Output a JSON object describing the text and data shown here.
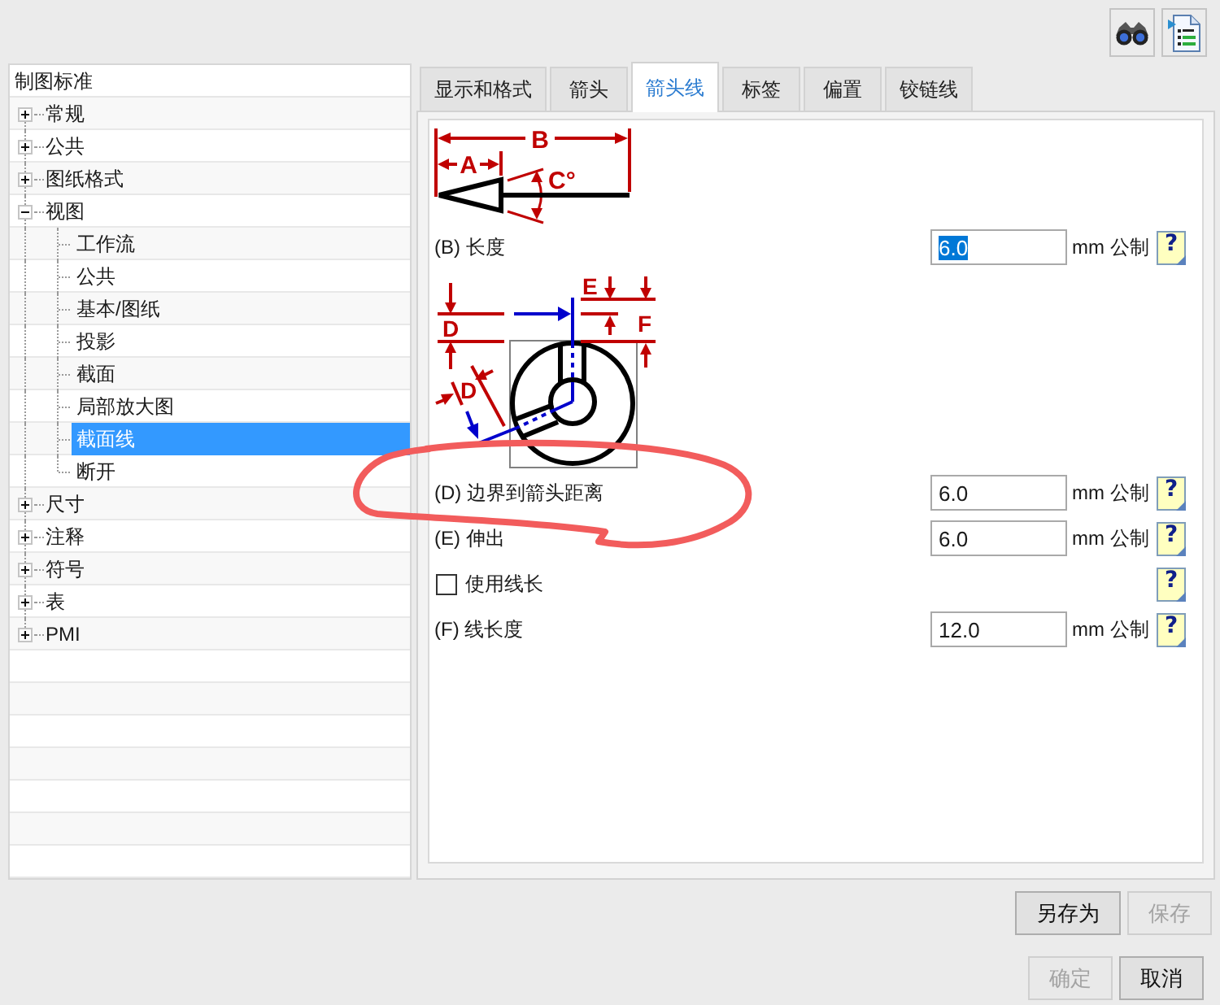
{
  "tree": {
    "title": "制图标准",
    "items": [
      {
        "label": "常规",
        "expanded": false,
        "selected": false
      },
      {
        "label": "公共",
        "expanded": false,
        "selected": false
      },
      {
        "label": "图纸格式",
        "expanded": false,
        "selected": false
      },
      {
        "label": "视图",
        "expanded": true,
        "selected": false,
        "children": [
          {
            "label": "工作流",
            "selected": false
          },
          {
            "label": "公共",
            "selected": false
          },
          {
            "label": "基本/图纸",
            "selected": false
          },
          {
            "label": "投影",
            "selected": false
          },
          {
            "label": "截面",
            "selected": false
          },
          {
            "label": "局部放大图",
            "selected": false
          },
          {
            "label": "截面线",
            "selected": true
          },
          {
            "label": "断开",
            "selected": false
          }
        ]
      },
      {
        "label": "尺寸",
        "expanded": false,
        "selected": false
      },
      {
        "label": "注释",
        "expanded": false,
        "selected": false
      },
      {
        "label": "符号",
        "expanded": false,
        "selected": false
      },
      {
        "label": "表",
        "expanded": false,
        "selected": false
      },
      {
        "label": "PMI",
        "expanded": false,
        "selected": false
      }
    ]
  },
  "tabs": [
    {
      "label": "显示和格式",
      "selected": false
    },
    {
      "label": "箭头",
      "selected": false
    },
    {
      "label": "箭头线",
      "selected": true
    },
    {
      "label": "标签",
      "selected": false
    },
    {
      "label": "偏置",
      "selected": false
    },
    {
      "label": "铰链线",
      "selected": false
    }
  ],
  "panel": {
    "blocks": [
      {
        "kind": "arrow-diagram",
        "labels": [
          "B",
          "A",
          "C°"
        ]
      },
      {
        "kind": "field",
        "label": "(B) 长度",
        "value": "6.0",
        "highlighted": true,
        "unit": "mm 公制",
        "help": "?"
      },
      {
        "kind": "section-diagram",
        "labels": [
          "E",
          "D",
          "F",
          "D"
        ]
      },
      {
        "kind": "field",
        "label": "(D) 边界到箭头距离",
        "value": "6.0",
        "highlighted": false,
        "unit": "mm 公制",
        "help": "?"
      },
      {
        "kind": "field",
        "label": "(E) 伸出",
        "value": "6.0",
        "highlighted": false,
        "unit": "mm 公制",
        "help": "?"
      },
      {
        "kind": "checkbox",
        "label": "使用线长",
        "checked": false,
        "help": "?"
      },
      {
        "kind": "field",
        "label": "(F) 线长度",
        "value": "12.0",
        "highlighted": false,
        "unit": "mm 公制",
        "help": "?"
      }
    ]
  },
  "button_rows": [
    {
      "buttons": [
        {
          "label": "另存为",
          "disabled": false
        },
        {
          "label": "保存",
          "disabled": true
        }
      ]
    },
    {
      "buttons": [
        {
          "label": "确定",
          "disabled": true
        },
        {
          "label": "取消",
          "disabled": false
        }
      ]
    }
  ],
  "annotations": [
    {
      "kind": "freehand-ellipse"
    }
  ]
}
